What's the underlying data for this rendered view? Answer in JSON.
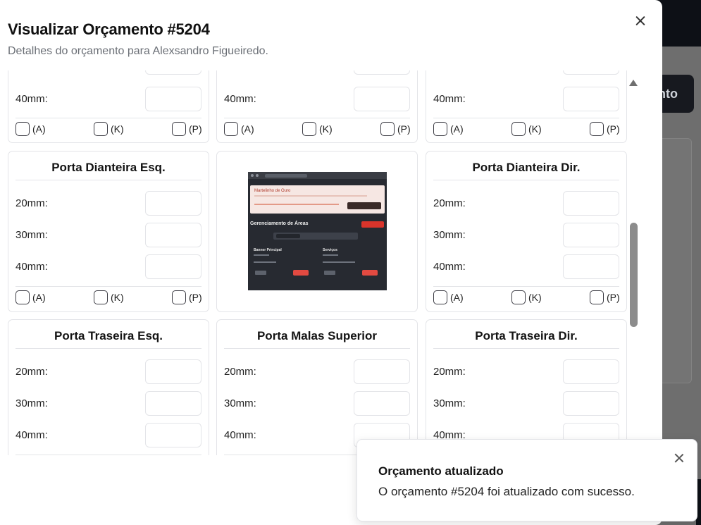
{
  "background": {
    "button_text": "nto"
  },
  "modal": {
    "title": "Visualizar Orçamento #5204",
    "subtitle": "Detalhes do orçamento para Alexsandro Figueiredo."
  },
  "measures": {
    "mm20": "20mm:",
    "mm30": "30mm:",
    "mm40": "40mm:"
  },
  "checks": {
    "a": "(A)",
    "k": "(K)",
    "p": "(P)"
  },
  "cards": {
    "front_left": "Porta Dianteira Esq.",
    "front_right": "Porta Dianteira Dir.",
    "rear_left": "Porta Traseira Esq.",
    "trunk_top": "Porta Malas Superior",
    "rear_right": "Porta Traseira Dir."
  },
  "preview": {
    "notice_title": "Martelinho de Ouro",
    "heading": "Gerenciamento de Áreas",
    "col1_title": "Banner Principal",
    "col2_title": "Serviços"
  },
  "toast": {
    "title": "Orçamento atualizado",
    "message": "O orçamento #5204 foi atualizado com sucesso."
  }
}
